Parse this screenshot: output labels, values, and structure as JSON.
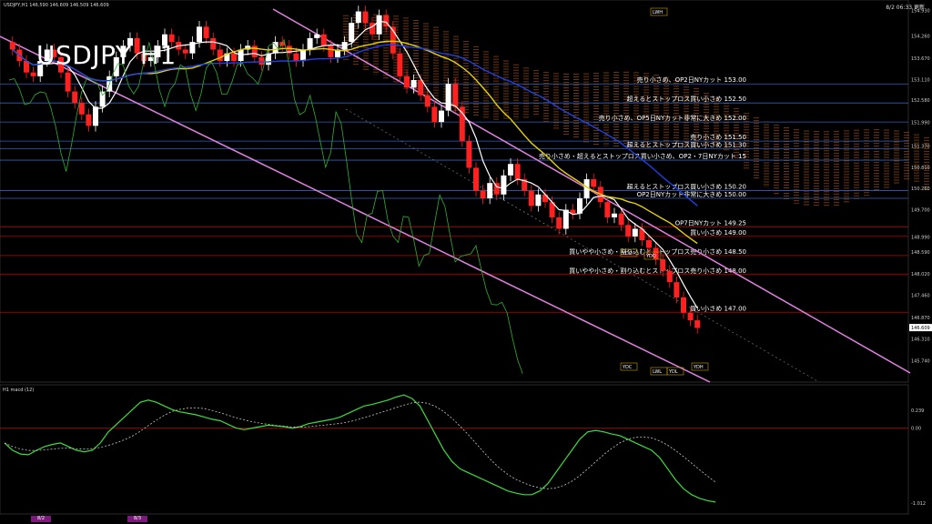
{
  "header": {
    "symbol_line": "USDJPY,H1  146.590 146.609 146.509 146.609",
    "time": "8/2 06:33 更新",
    "title": "USDJPY H1"
  },
  "macd_label": "H1 macd (12)",
  "price_axis": [
    "154.930",
    "154.260",
    "153.670",
    "153.110",
    "152.580",
    "151.990",
    "151.370",
    "150.810",
    "150.260",
    "149.700",
    "148.990",
    "148.590",
    "148.020",
    "147.460",
    "146.870",
    "146.310",
    "145.740",
    "145.180"
  ],
  "current_price": "146.609",
  "macd_axis": [
    "0.239",
    "0.00",
    "-1.012"
  ],
  "macd_right": "8002",
  "level_labels": [
    {
      "text": "売り小さめ、OP2日NYカット 153.00",
      "price": 153.0
    },
    {
      "text": "超えるとストップロス買い小さめ 152.50",
      "price": 152.5
    },
    {
      "text": "売り小さめ、OP5日NYカット非常に大きめ 152.00",
      "price": 152.0
    },
    {
      "text": "売り小さめ 151.50",
      "price": 151.5
    },
    {
      "text": "超えるとストップロス買い小さめ 151.30",
      "price": 151.3
    },
    {
      "text": "売り小さめ・超えるとストップロス買い小さめ、OP2・7日NYカット 15",
      "price": 151.0
    },
    {
      "text": "超えるとストップロス買い小さめ 150.20",
      "price": 150.2
    },
    {
      "text": "OP2日NYカット非常に大きめ 150.00",
      "price": 150.0
    },
    {
      "text": "OP7日NYカット 149.25",
      "price": 149.25
    },
    {
      "text": "買い小さめ 149.00",
      "price": 149.0
    },
    {
      "text": "買いやや小さめ・割り込むとストップロス売り小さめ 148.50",
      "price": 148.5
    },
    {
      "text": "買いやや小さめ・割り込むとストップロス売り小さめ 148.00",
      "price": 148.0
    },
    {
      "text": "買い小さめ 147.00",
      "price": 147.0
    }
  ],
  "box_labels": [
    "LWH",
    "YDO",
    "YDO",
    "YDC",
    "LWL",
    "YDL",
    "YDH"
  ],
  "bottom_tabs": [
    "8/2",
    "8/3"
  ],
  "colors": {
    "bull": "#ffffff",
    "bear": "#ff2020",
    "cloud": "#c86414",
    "channel": "#e080e0",
    "macd_bull": "#3cdc3c",
    "macd_bear": "#e87896",
    "signal": "#c8c8c8",
    "level_red": "#c00000",
    "level_blue": "#3060c0"
  },
  "chart_data": {
    "type": "candlestick",
    "title": "USDJPY H1",
    "ylim": [
      145.18,
      155.2
    ],
    "closes": [
      153.9,
      153.6,
      153.3,
      153.2,
      153.6,
      153.9,
      153.7,
      153.3,
      152.8,
      152.5,
      152.2,
      151.9,
      152.4,
      152.8,
      153.2,
      153.7,
      154.0,
      154.2,
      153.8,
      153.6,
      153.7,
      154.0,
      154.3,
      154.1,
      153.9,
      153.8,
      154.1,
      154.5,
      154.2,
      153.9,
      153.6,
      153.8,
      153.6,
      153.9,
      154.0,
      153.7,
      153.5,
      153.8,
      154.1,
      154.0,
      153.8,
      153.6,
      153.9,
      154.2,
      154.3,
      154.0,
      153.7,
      153.9,
      154.1,
      154.6,
      154.9,
      154.6,
      154.3,
      154.8,
      154.5,
      153.8,
      153.2,
      152.9,
      153.1,
      152.7,
      152.4,
      152.0,
      152.3,
      153.0,
      152.4,
      151.5,
      150.8,
      150.2,
      150.0,
      150.4,
      150.1,
      150.6,
      150.9,
      150.5,
      150.2,
      149.8,
      150.1,
      149.9,
      149.5,
      149.2,
      149.7,
      149.6,
      150.0,
      150.5,
      150.3,
      149.9,
      149.5,
      149.6,
      149.3,
      149.0,
      149.2,
      148.9,
      148.7,
      148.4,
      148.1,
      147.8,
      147.4,
      147.0,
      146.8,
      146.6
    ],
    "macd": [
      -0.2,
      -0.3,
      -0.35,
      -0.36,
      -0.3,
      -0.25,
      -0.22,
      -0.2,
      -0.25,
      -0.3,
      -0.32,
      -0.3,
      -0.2,
      -0.05,
      0.05,
      0.15,
      0.25,
      0.35,
      0.38,
      0.35,
      0.3,
      0.25,
      0.22,
      0.2,
      0.18,
      0.15,
      0.12,
      0.1,
      0.05,
      0.0,
      -0.02,
      0.0,
      0.02,
      0.04,
      0.03,
      0.02,
      0.0,
      0.02,
      0.06,
      0.08,
      0.1,
      0.12,
      0.15,
      0.2,
      0.25,
      0.3,
      0.32,
      0.35,
      0.38,
      0.42,
      0.45,
      0.4,
      0.3,
      0.1,
      -0.1,
      -0.3,
      -0.45,
      -0.55,
      -0.6,
      -0.65,
      -0.7,
      -0.75,
      -0.8,
      -0.85,
      -0.88,
      -0.9,
      -0.9,
      -0.85,
      -0.75,
      -0.6,
      -0.45,
      -0.3,
      -0.15,
      -0.05,
      -0.03,
      -0.05,
      -0.08,
      -0.1,
      -0.15,
      -0.2,
      -0.25,
      -0.3,
      -0.4,
      -0.55,
      -0.7,
      -0.82,
      -0.9,
      -0.95,
      -0.98,
      -1.0
    ]
  }
}
